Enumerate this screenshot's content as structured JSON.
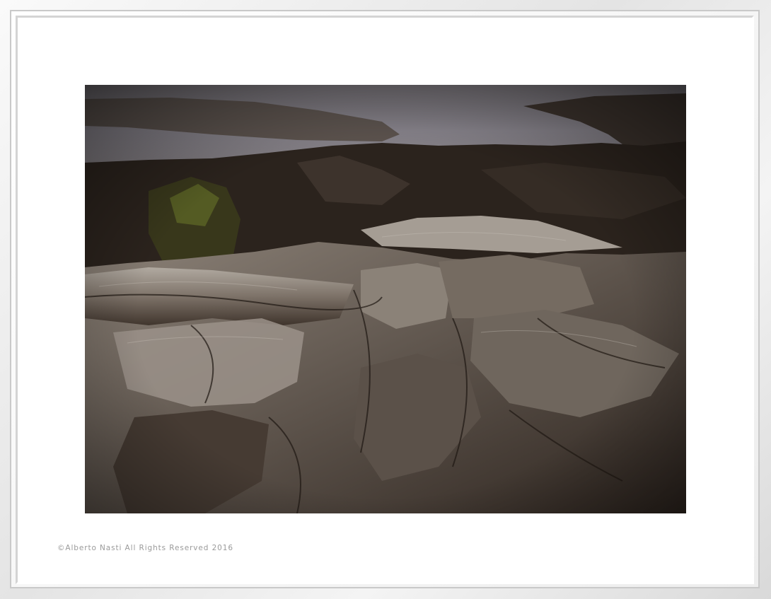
{
  "photo": {
    "subject": "rocky-shoreline",
    "colors": {
      "sky_water": "#7d7a7e",
      "rock_dark": "#2a211b",
      "rock_light": "#b9b3ab",
      "moss": "#6b7a2a"
    }
  },
  "caption": {
    "copyright": "©Alberto Nasti All Rights Reserved 2016"
  }
}
